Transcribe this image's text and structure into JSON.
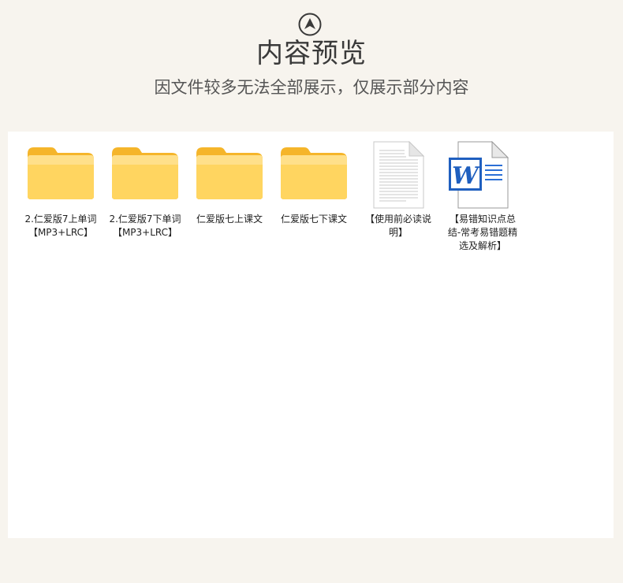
{
  "header": {
    "top_icon": "chevron-up-circle-icon",
    "title": "内容预览",
    "subtitle": "因文件较多无法全部展示，仅展示部分内容"
  },
  "files": [
    {
      "icon": "folder-icon",
      "label": "2.仁爱版7上单词【MP3+LRC】"
    },
    {
      "icon": "folder-icon",
      "label": "2.仁爱版7下单词【MP3+LRC】"
    },
    {
      "icon": "folder-icon",
      "label": "仁爱版七上课文"
    },
    {
      "icon": "folder-icon",
      "label": "仁爱版七下课文"
    },
    {
      "icon": "text-document-icon",
      "label": "【使用前必读说明】"
    },
    {
      "icon": "word-document-icon",
      "label": "【易错知识点总结-常考易错题精选及解析】"
    }
  ],
  "colors": {
    "page_bg": "#f7f4ee",
    "folder_light": "#ffdb76",
    "folder_dark": "#f5b52a",
    "word_blue": "#1f5fbf"
  }
}
